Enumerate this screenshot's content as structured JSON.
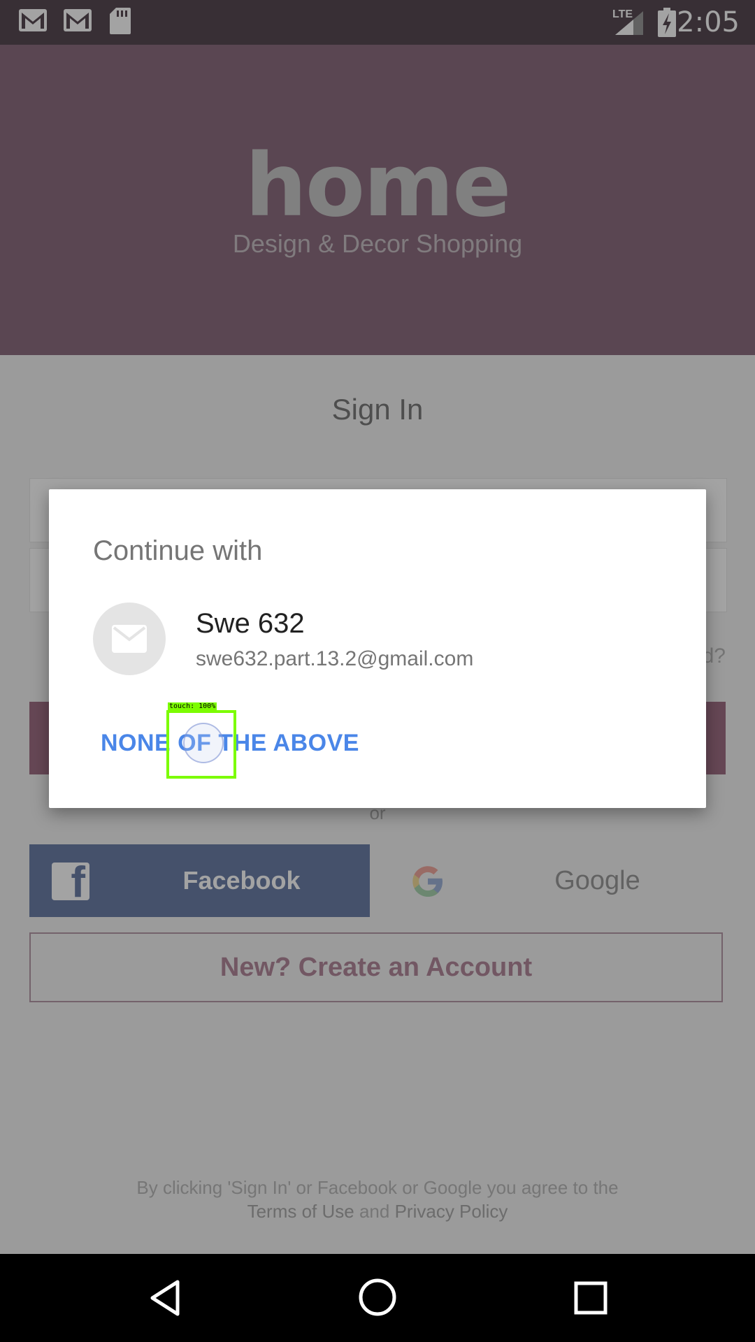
{
  "status_bar": {
    "time": "2:05",
    "network": "LTE",
    "icons": [
      "gmail-icon",
      "gmail-icon",
      "sd-card-icon",
      "signal-icon",
      "battery-charging-icon"
    ]
  },
  "header": {
    "logo_text": "home",
    "tagline": "Design & Decor Shopping"
  },
  "sign_in": {
    "title": "Sign In",
    "forgot_suffix": "d?",
    "or_text": "or",
    "facebook_label": "Facebook",
    "google_label": "Google",
    "create_account_label": "New? Create an Account",
    "legal_line1": "By clicking 'Sign In' or Facebook or Google you agree to the",
    "legal_terms": "Terms of Use",
    "legal_and": " and ",
    "legal_privacy": "Privacy Policy"
  },
  "dialog": {
    "title": "Continue with",
    "account_name": "Swe 632",
    "account_email": "swe632.part.13.2@gmail.com",
    "none_button": "NONE OF THE ABOVE"
  },
  "touch_overlay": {
    "label": "touch: 100%"
  },
  "colors": {
    "status_bar": "#584a53",
    "header": "#8d6e80",
    "accent_button": "#a07086",
    "facebook": "#6c7fa8",
    "dialog_link": "#4a86e8",
    "touch_box": "#7cfc00"
  }
}
